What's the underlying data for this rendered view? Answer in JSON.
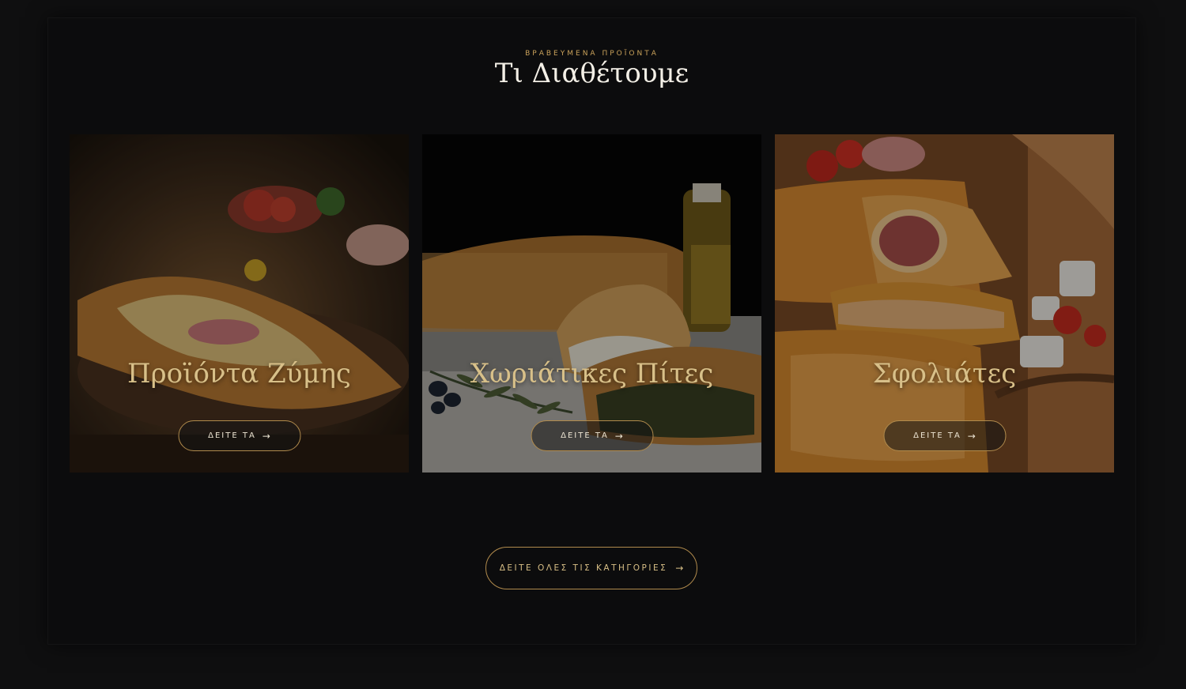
{
  "section": {
    "eyebrow": "ΒΡΑΒΕΥΜΕΝΑ ΠΡΟΪΟΝΤΑ",
    "heading": "Τι Διαθέτουμε"
  },
  "cards": [
    {
      "title": "Προϊόντα Ζύμης",
      "cta": "ΔΕΙΤΕ ΤΑ",
      "arrow": "→"
    },
    {
      "title": "Χωριάτικες Πίτες",
      "cta": "ΔΕΙΤΕ ΤΑ",
      "arrow": "→"
    },
    {
      "title": "Σφολιάτες",
      "cta": "ΔΕΙΤΕ ΤΑ",
      "arrow": "→"
    }
  ],
  "all_categories": {
    "label": "ΔΕΙΤΕ ΟΛΕΣ ΤΙΣ ΚΑΤΗΓΟΡΙΕΣ",
    "arrow": "→"
  },
  "colors": {
    "background": "#0f0f10",
    "accent": "#c9a15a",
    "card_title": "#d8c089"
  },
  "icons": {
    "arrow": "arrow-right-icon"
  }
}
